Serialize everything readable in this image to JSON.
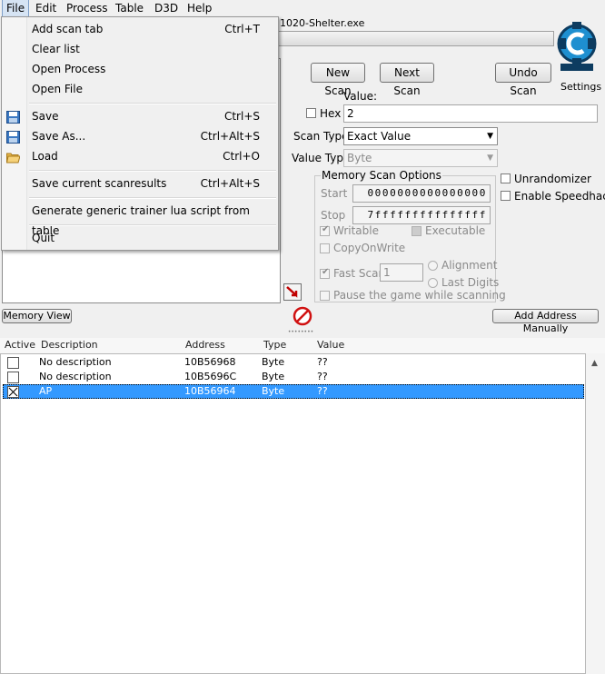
{
  "menubar": {
    "items": [
      {
        "label": "File"
      },
      {
        "label": "Edit"
      },
      {
        "label": "Process"
      },
      {
        "label": "Table"
      },
      {
        "label": "D3D"
      },
      {
        "label": "Help"
      }
    ]
  },
  "process": {
    "title": "1020-Shelter.exe"
  },
  "logo": {
    "settings_label": "Settings",
    "colors": {
      "primary": "#1e8fd0",
      "dark": "#0d3c60"
    }
  },
  "file_menu": {
    "items": [
      {
        "label": "Add scan tab",
        "shortcut": "Ctrl+T"
      },
      {
        "label": "Clear list",
        "shortcut": ""
      },
      {
        "label": "Open Process",
        "shortcut": ""
      },
      {
        "label": "Open File",
        "shortcut": ""
      },
      {
        "label": "Save",
        "shortcut": "Ctrl+S",
        "icon": "floppy-disk-icon"
      },
      {
        "label": "Save As...",
        "shortcut": "Ctrl+Alt+S",
        "icon": "floppy-disk-icon"
      },
      {
        "label": "Load",
        "shortcut": "Ctrl+O",
        "icon": "folder-open-icon"
      },
      {
        "label": "Save current scanresults",
        "shortcut": "Ctrl+Alt+S"
      },
      {
        "label": "Generate generic trainer lua script from table",
        "shortcut": ""
      },
      {
        "label": "Quit",
        "shortcut": ""
      }
    ]
  },
  "scan": {
    "new_scan": "New Scan",
    "next_scan": "Next Scan",
    "undo_scan": "Undo Scan",
    "value_label": "Value:",
    "hex_label": "Hex",
    "value": "2",
    "scan_type_label": "Scan Type",
    "scan_type_value": "Exact Value",
    "value_type_label": "Value Type",
    "value_type_value": "Byte",
    "memory_options_label": "Memory Scan Options",
    "start_label": "Start",
    "start_value": "0000000000000000",
    "stop_label": "Stop",
    "stop_value": "7fffffffffffffff",
    "writable_label": "Writable",
    "executable_label": "Executable",
    "copyonwrite_label": "CopyOnWrite",
    "fastscan_label": "Fast Scan",
    "fastscan_value": "1",
    "alignment_label": "Alignment",
    "last_digits_label": "Last Digits",
    "pause_label": "Pause the game while scanning",
    "unrandomizer_label": "Unrandomizer",
    "speedhack_label": "Enable Speedhack"
  },
  "toolbar": {
    "memory_view": "Memory View",
    "add_address": "Add Address Manually"
  },
  "table": {
    "headers": [
      "Active",
      "Description",
      "Address",
      "Type",
      "Value"
    ],
    "rows": [
      {
        "description": "No description",
        "address": "10B56968",
        "type": "Byte",
        "value": "??"
      },
      {
        "description": "No description",
        "address": "10B5696C",
        "type": "Byte",
        "value": "??"
      },
      {
        "description": "AP",
        "address": "10B56964",
        "type": "Byte",
        "value": "??"
      }
    ]
  },
  "colors": {
    "selection": "#3399ff",
    "stop_icon": "#d01010"
  }
}
